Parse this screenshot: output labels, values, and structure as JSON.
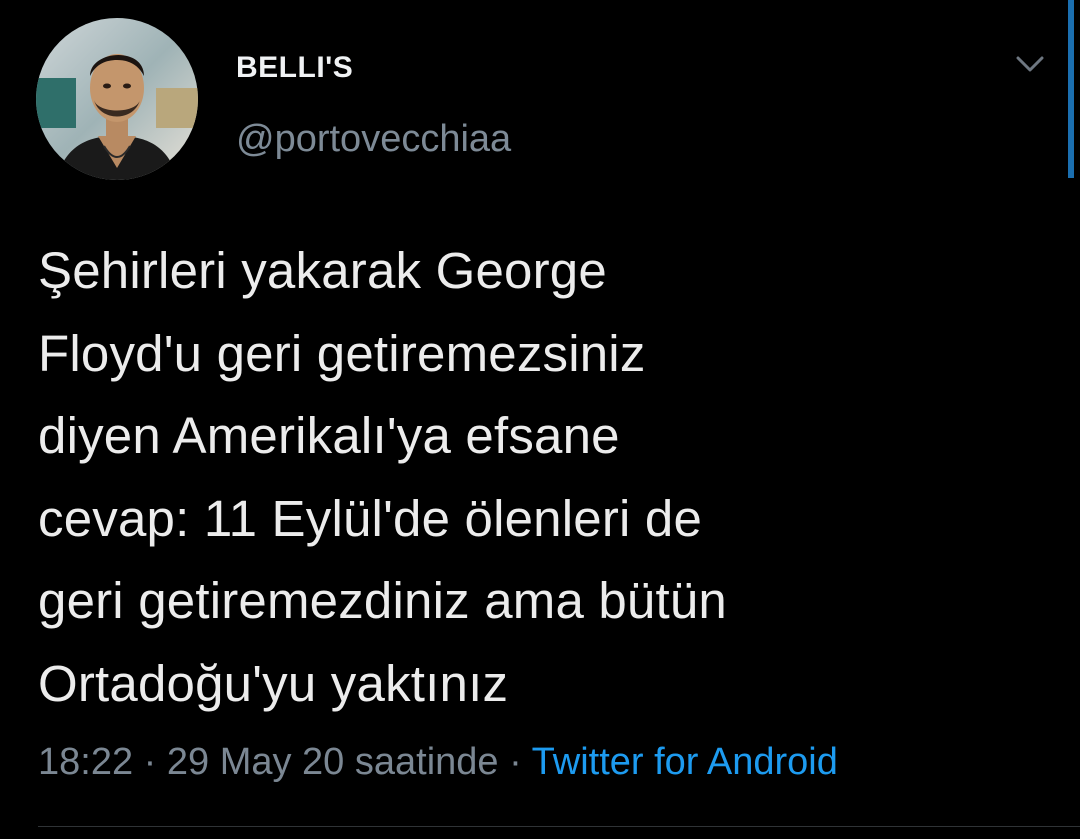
{
  "tweet": {
    "author": {
      "display_name": "BELLI'S",
      "handle": "@portovecchiaa",
      "avatar": "profile-photo"
    },
    "menu_icon": "chevron-down-icon",
    "text_lines": [
      "Şehirleri yakarak George",
      "Floyd'u geri getiremezsiniz",
      "diyen Amerikalı'ya efsane",
      "cevap: 11 Eylül'de ölenleri de",
      "geri getiremezdiniz ama bütün",
      "Ortadoğu'yu yaktınız"
    ],
    "time": "18:22",
    "separator": "·",
    "date": "29 May 20 saatinde",
    "source": "Twitter for Android"
  },
  "colors": {
    "background": "#000000",
    "text": "#ececec",
    "muted": "#7b8793",
    "link": "#1d9bf0",
    "accent_bar": "#1b6fb0"
  }
}
